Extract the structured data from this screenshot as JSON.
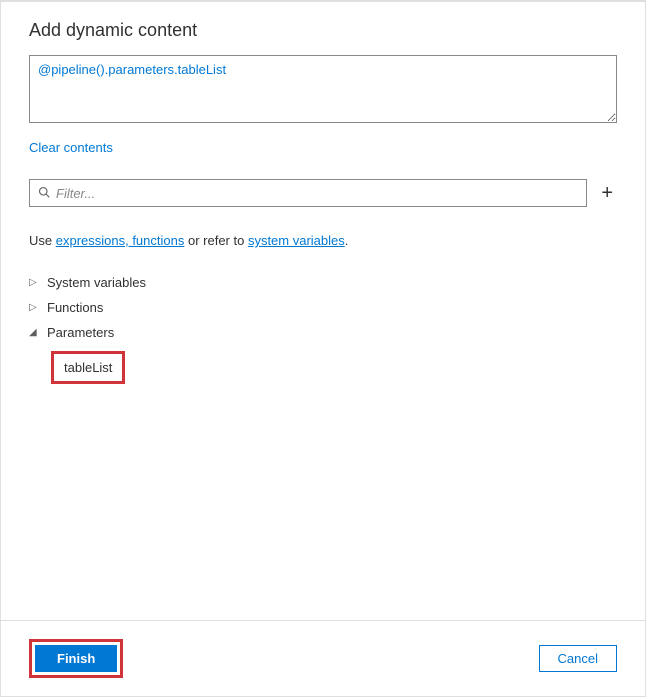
{
  "header": {
    "title": "Add dynamic content"
  },
  "expression": {
    "value": "@pipeline().parameters.tableList"
  },
  "actions": {
    "clear": "Clear contents"
  },
  "filter": {
    "placeholder": "Filter..."
  },
  "help": {
    "prefix": "Use ",
    "link1": "expressions, functions",
    "mid": " or refer to ",
    "link2": "system variables",
    "suffix": "."
  },
  "tree": {
    "nodes": [
      {
        "label": "System variables",
        "expanded": false
      },
      {
        "label": "Functions",
        "expanded": false
      },
      {
        "label": "Parameters",
        "expanded": true
      }
    ],
    "parameter_child": "tableList"
  },
  "footer": {
    "finish": "Finish",
    "cancel": "Cancel"
  }
}
